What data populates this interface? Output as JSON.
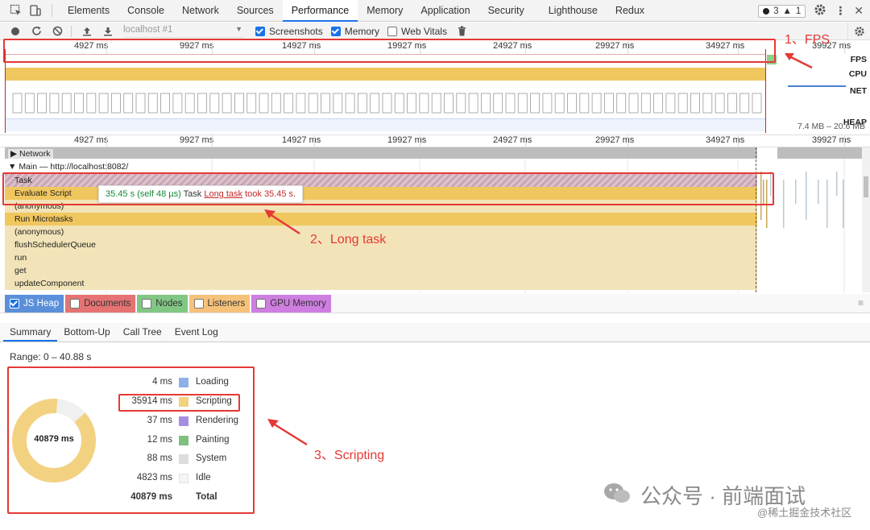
{
  "devtools": {
    "tabs": [
      "Elements",
      "Console",
      "Network",
      "Sources",
      "Performance",
      "Memory",
      "Application",
      "Security",
      "Lighthouse",
      "Redux"
    ],
    "active_tab": "Performance",
    "issues_errors": "3",
    "issues_warnings": "1"
  },
  "toolbar": {
    "url_select": "localhost #1",
    "screenshots_label": "Screenshots",
    "screenshots_checked": true,
    "memory_label": "Memory",
    "memory_checked": true,
    "web_vitals_label": "Web Vitals",
    "web_vitals_checked": false
  },
  "overview": {
    "ticks": [
      "4927 ms",
      "9927 ms",
      "14927 ms",
      "19927 ms",
      "24927 ms",
      "29927 ms",
      "34927 ms",
      "39927 ms"
    ],
    "tracks": [
      "FPS",
      "CPU",
      "NET",
      "HEAP"
    ],
    "heap_range": "7.4 MB – 20.6 MB"
  },
  "flame": {
    "ticks": [
      "4927 ms",
      "9927 ms",
      "14927 ms",
      "19927 ms",
      "24927 ms",
      "29927 ms",
      "34927 ms",
      "39927 ms"
    ],
    "network_label": "Network",
    "main_label": "Main — http://localhost:8082/",
    "rows": [
      "Task",
      "Evaluate Script",
      "(anonymous)",
      "Run Microtasks",
      "(anonymous)",
      "flushSchedulerQueue",
      "run",
      "get",
      "updateComponent"
    ],
    "tooltip": {
      "duration": "35.45 s (self 48 µs)",
      "name": "Task",
      "link": "Long task",
      "rest": "took 35.45 s."
    }
  },
  "counters": [
    {
      "label": "JS Heap",
      "checked": true,
      "color": "#5b8fd9"
    },
    {
      "label": "Documents",
      "checked": false,
      "color": "#e57373"
    },
    {
      "label": "Nodes",
      "checked": false,
      "color": "#81c784"
    },
    {
      "label": "Listeners",
      "checked": false,
      "color": "#f6c27a"
    },
    {
      "label": "GPU Memory",
      "checked": false,
      "color": "#ce7ee0"
    }
  ],
  "bottom_tabs": [
    "Summary",
    "Bottom-Up",
    "Call Tree",
    "Event Log"
  ],
  "bottom_active": "Summary",
  "summary": {
    "range": "Range: 0 – 40.88 s",
    "total_center": "40879 ms",
    "rows": [
      {
        "value": "4 ms",
        "label": "Loading",
        "color": "#8fb0e6"
      },
      {
        "value": "35914 ms",
        "label": "Scripting",
        "color": "#f2d281"
      },
      {
        "value": "37 ms",
        "label": "Rendering",
        "color": "#a88ee3"
      },
      {
        "value": "12 ms",
        "label": "Painting",
        "color": "#7fbf7f"
      },
      {
        "value": "88 ms",
        "label": "System",
        "color": "#dcdcdc"
      },
      {
        "value": "4823 ms",
        "label": "Idle",
        "color": "#f5f5f5"
      },
      {
        "value": "40879 ms",
        "label": "Total",
        "color": ""
      }
    ]
  },
  "annotations": {
    "fps": "1、FPS",
    "long_task": "2、Long task",
    "scripting": "3、Scripting"
  },
  "watermark": {
    "main": "公众号 · 前端面试",
    "sub": "@稀土掘金技术社区"
  }
}
